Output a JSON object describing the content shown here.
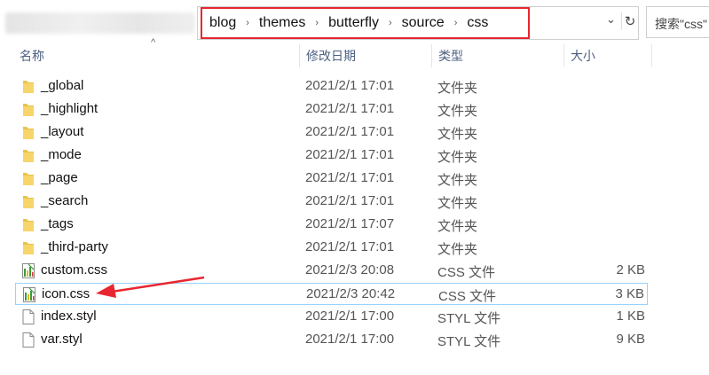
{
  "address_bar": {
    "breadcrumbs": [
      "blog",
      "themes",
      "butterfly",
      "source",
      "css"
    ],
    "separator": "›",
    "dropdown_icon": "chevron-down-icon",
    "refresh_icon": "refresh-icon",
    "search_placeholder": "搜索\"css\"",
    "highlight_color": "#e8262f"
  },
  "columns": {
    "name": "名称",
    "modified": "修改日期",
    "type": "类型",
    "size": "大小"
  },
  "files": [
    {
      "name": "_global",
      "modified": "2021/2/1 17:01",
      "type": "文件夹",
      "size": "",
      "icon": "folder-icon"
    },
    {
      "name": "_highlight",
      "modified": "2021/2/1 17:01",
      "type": "文件夹",
      "size": "",
      "icon": "folder-icon"
    },
    {
      "name": "_layout",
      "modified": "2021/2/1 17:01",
      "type": "文件夹",
      "size": "",
      "icon": "folder-icon"
    },
    {
      "name": "_mode",
      "modified": "2021/2/1 17:01",
      "type": "文件夹",
      "size": "",
      "icon": "folder-icon"
    },
    {
      "name": "_page",
      "modified": "2021/2/1 17:01",
      "type": "文件夹",
      "size": "",
      "icon": "folder-icon"
    },
    {
      "name": "_search",
      "modified": "2021/2/1 17:01",
      "type": "文件夹",
      "size": "",
      "icon": "folder-icon"
    },
    {
      "name": "_tags",
      "modified": "2021/2/1 17:07",
      "type": "文件夹",
      "size": "",
      "icon": "folder-icon"
    },
    {
      "name": "_third-party",
      "modified": "2021/2/1 17:01",
      "type": "文件夹",
      "size": "",
      "icon": "folder-icon"
    },
    {
      "name": "custom.css",
      "modified": "2021/2/3 20:08",
      "type": "CSS 文件",
      "size": "2 KB",
      "icon": "css-file-icon"
    },
    {
      "name": "icon.css",
      "modified": "2021/2/3 20:42",
      "type": "CSS 文件",
      "size": "3 KB",
      "icon": "css-file-icon",
      "selected": true
    },
    {
      "name": "index.styl",
      "modified": "2021/2/1 17:00",
      "type": "STYL 文件",
      "size": "1 KB",
      "icon": "file-icon"
    },
    {
      "name": "var.styl",
      "modified": "2021/2/1 17:00",
      "type": "STYL 文件",
      "size": "9 KB",
      "icon": "file-icon"
    }
  ],
  "annotation": {
    "arrow_color": "#e8262f",
    "points_to": "icon.css"
  }
}
